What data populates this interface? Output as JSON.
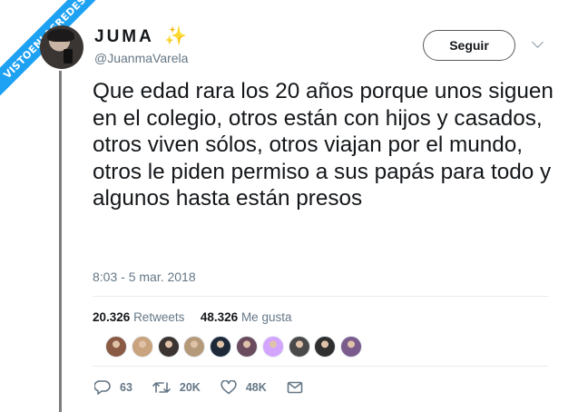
{
  "watermark": {
    "text": "VISTOENLASREDES"
  },
  "user": {
    "name": "JUMA",
    "name_emoji": "✨",
    "handle": "@JuanmaVarela",
    "follow_label": "Seguir"
  },
  "tweet": {
    "text": "Que edad rara los 20 años porque unos siguen en el colegio, otros están con hijos y casados, otros viven sólos, otros viajan por el mundo, otros le piden permiso a sus papás para todo y algunos hasta están presos",
    "timestamp": "8:03 - 5 mar. 2018"
  },
  "stats": {
    "retweets_count": "20.326",
    "retweets_label": "Retweets",
    "likes_count": "48.326",
    "likes_label": "Me gusta"
  },
  "likers": [
    {
      "color": "#8a5a44"
    },
    {
      "color": "#c9a27e"
    },
    {
      "color": "#3b3430"
    },
    {
      "color": "#b59a7a"
    },
    {
      "color": "#1e2a3a"
    },
    {
      "color": "#6b4b5e"
    },
    {
      "color": "#d4a5ff"
    },
    {
      "color": "#4a4a4a"
    },
    {
      "color": "#2f2f2f"
    },
    {
      "color": "#7a5b8c"
    }
  ],
  "actions": {
    "replies": "63",
    "retweets": "20K",
    "likes": "48K"
  },
  "colors": {
    "accent": "#1da1f2",
    "text": "#14171a",
    "secondary": "#657786"
  }
}
